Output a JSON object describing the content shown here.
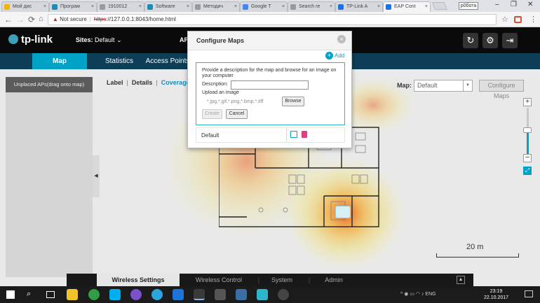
{
  "browser": {
    "tabs": [
      {
        "label": "Мой дис",
        "color": "#f2b600"
      },
      {
        "label": "Програм",
        "color": "#1a8bb9"
      },
      {
        "label": "1910012",
        "color": "#999999"
      },
      {
        "label": "Software",
        "color": "#1a8bb9"
      },
      {
        "label": "Методич",
        "color": "#999999"
      },
      {
        "label": "Google T",
        "color": "#4285f4"
      },
      {
        "label": "Search re",
        "color": "#999999"
      },
      {
        "label": "TP-Link A",
        "color": "#1a73e8"
      },
      {
        "label": "EAP Cont",
        "color": "#1a73e8"
      }
    ],
    "profile": "р0бота",
    "security": "Not secure",
    "url_scheme": "https",
    "url_rest": "://127.0.0.1:8043/home.html"
  },
  "app": {
    "logo": "tp-link",
    "sites_label": "Sites:",
    "sites_value": "Default",
    "ap_count_label": "AP",
    "nav": [
      "Map",
      "Statistics",
      "Access Points"
    ],
    "left_panel_title": "Unplaced APs(drag onto map)",
    "view_tabs": [
      "Label",
      "Details",
      "Coverage"
    ],
    "map_label": "Map:",
    "map_select": "Default",
    "configure_maps_button": "Configure Maps",
    "scale_label": "20 m",
    "bottom_tabs": [
      "Wireless Settings",
      "Wireless Control",
      "System",
      "Admin"
    ]
  },
  "dialog": {
    "title": "Configure Maps",
    "add_label": "Add",
    "description_text": "Provide a description for the map and browse for an image on your computer",
    "description_label": "Description:",
    "description_value": "",
    "upload_label": "Upload an image",
    "formats": "*.jpg,*.gif,*.png,*.bmp,*.tiff",
    "browse_button": "Browse",
    "create_button": "Create",
    "cancel_button": "Cancel",
    "maps": [
      {
        "name": "Default"
      }
    ]
  },
  "taskbar": {
    "language": "ENG",
    "time": "23:19",
    "date": "22.10.2017"
  }
}
